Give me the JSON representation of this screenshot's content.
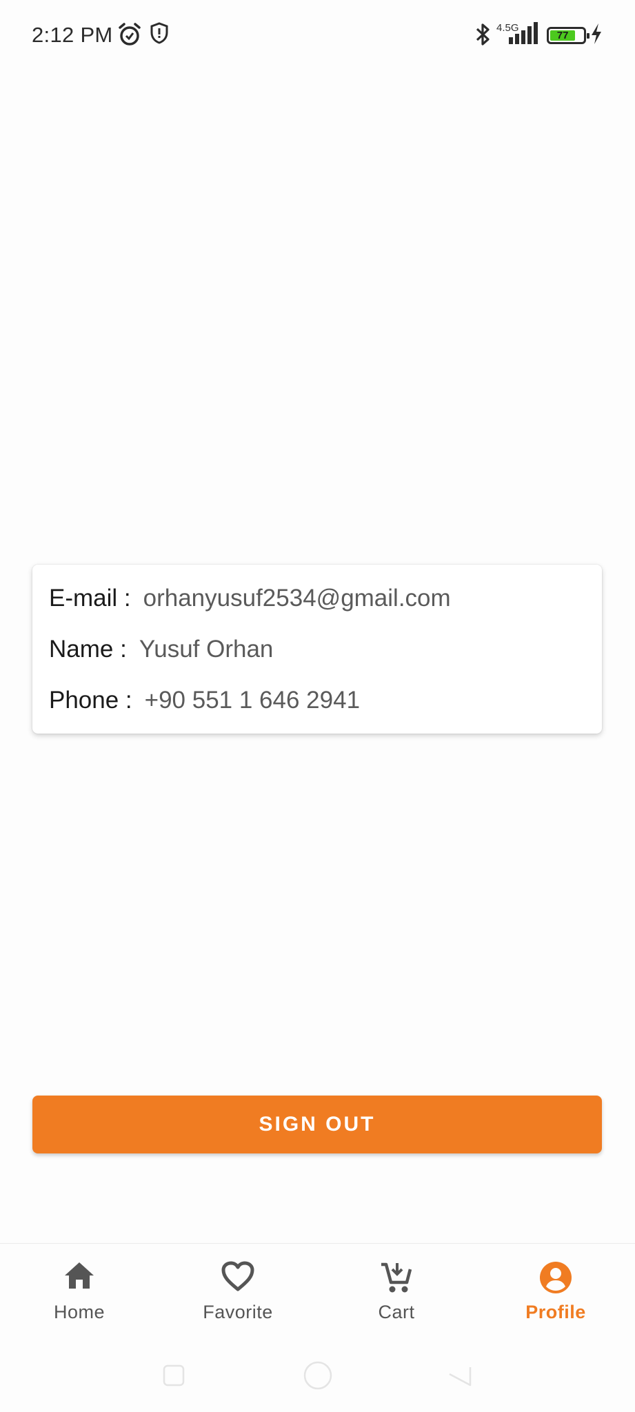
{
  "status_bar": {
    "time": "2:12 PM",
    "network": "4.5G",
    "battery_level": "77",
    "icons": [
      "alarm-icon",
      "shield-icon",
      "bluetooth-icon",
      "signal-icon",
      "battery-icon",
      "charging-icon"
    ]
  },
  "profile": {
    "email_label": "E-mail :",
    "email_value": "orhanyusuf2534@gmail.com",
    "name_label": "Name :",
    "name_value": "Yusuf Orhan",
    "phone_label": "Phone :",
    "phone_value": "+90 551 1 646 2941"
  },
  "actions": {
    "sign_out_label": "SIGN OUT"
  },
  "bottom_nav": {
    "items": [
      {
        "label": "Home",
        "icon": "home-icon"
      },
      {
        "label": "Favorite",
        "icon": "heart-icon"
      },
      {
        "label": "Cart",
        "icon": "cart-icon"
      },
      {
        "label": "Profile",
        "icon": "profile-icon"
      }
    ],
    "active": "Profile"
  },
  "colors": {
    "accent": "#f07c22",
    "battery_fill": "#4cc91e",
    "icon_inactive": "#555555"
  }
}
